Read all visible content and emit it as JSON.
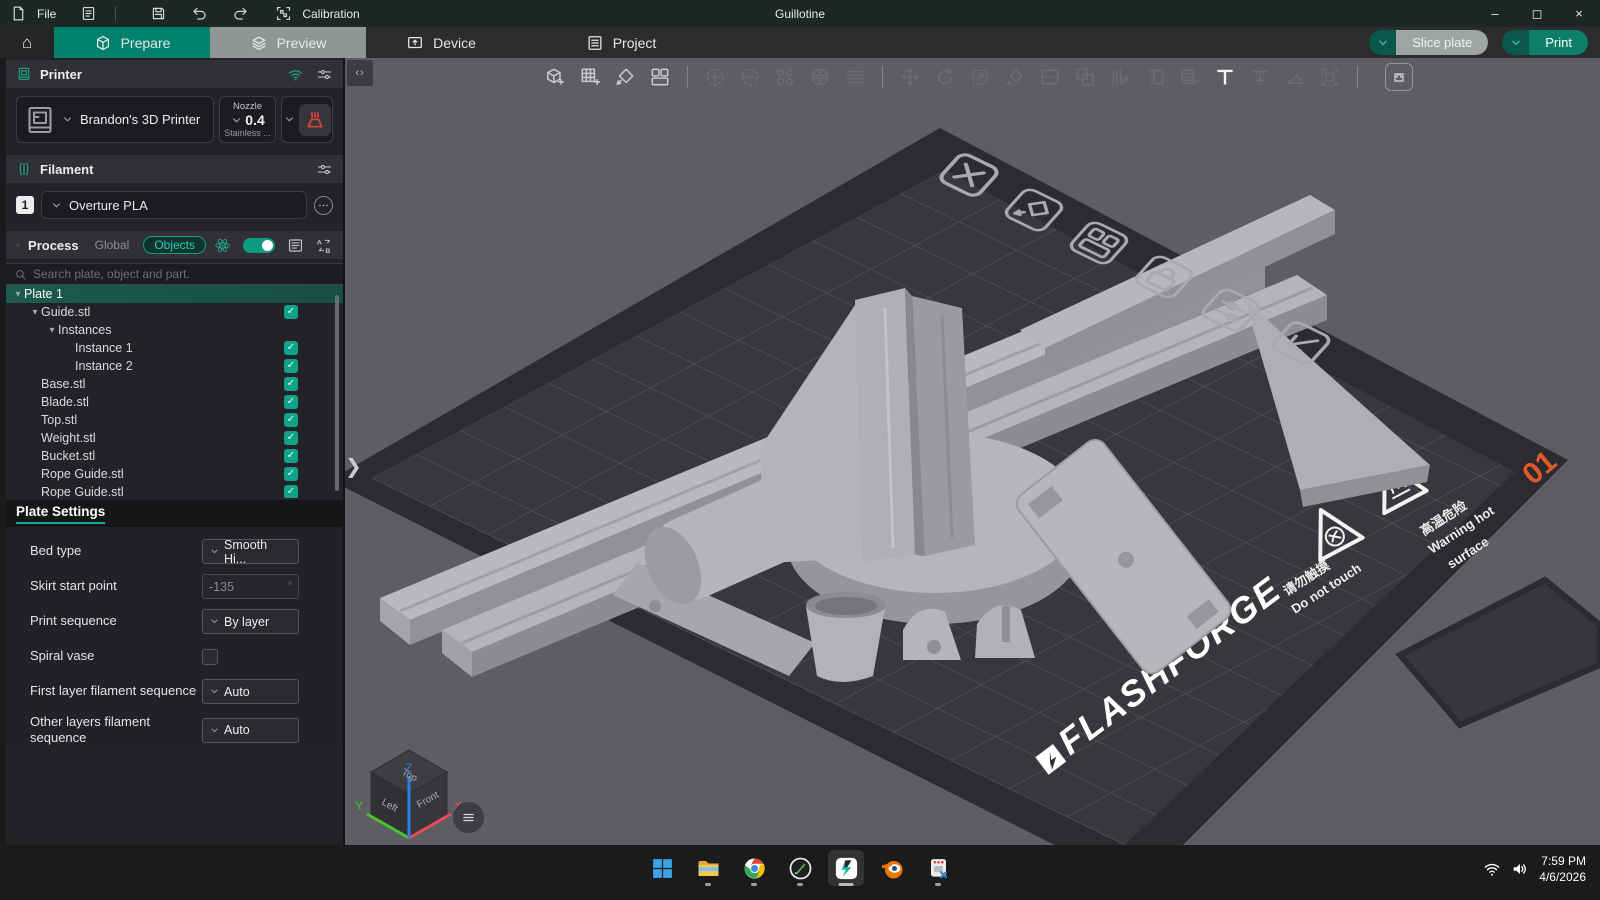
{
  "app": {
    "title": "Guillotine"
  },
  "menubar": {
    "file": "File",
    "calibration": "Calibration"
  },
  "window_controls": {
    "minimize": "–",
    "maximize": "◻",
    "close": "×"
  },
  "tabs": {
    "prepare": "Prepare",
    "preview": "Preview",
    "device": "Device",
    "project": "Project"
  },
  "actions": {
    "slice": "Slice plate",
    "print": "Print"
  },
  "printer": {
    "header": "Printer",
    "name": "Brandon's 3D Printer",
    "nozzle_label": "Nozzle",
    "nozzle_value": "0.4",
    "nozzle_material": "Stainless ..."
  },
  "filament": {
    "header": "Filament",
    "slot": "1",
    "name": "Overture PLA"
  },
  "process": {
    "header": "Process",
    "mode_global": "Global",
    "mode_objects": "Objects"
  },
  "search": {
    "placeholder": "Search plate, object and part."
  },
  "tree": {
    "rows": [
      {
        "label": "Plate 1",
        "level": 0,
        "caret": true,
        "selected": true,
        "checked": false
      },
      {
        "label": "Guide.stl",
        "level": 1,
        "caret": true,
        "checked": true
      },
      {
        "label": "Instances",
        "level": 2,
        "caret": true,
        "checked": false
      },
      {
        "label": "Instance 1",
        "level": 3,
        "caret": false,
        "checked": true
      },
      {
        "label": "Instance 2",
        "level": 3,
        "caret": false,
        "checked": true
      },
      {
        "label": "Base.stl",
        "level": 1,
        "caret": false,
        "checked": true
      },
      {
        "label": "Blade.stl",
        "level": 1,
        "caret": false,
        "checked": true
      },
      {
        "label": "Top.stl",
        "level": 1,
        "caret": false,
        "checked": true
      },
      {
        "label": "Weight.stl",
        "level": 1,
        "caret": false,
        "checked": true
      },
      {
        "label": "Bucket.stl",
        "level": 1,
        "caret": false,
        "checked": true
      },
      {
        "label": "Rope Guide.stl",
        "level": 1,
        "caret": false,
        "checked": true
      },
      {
        "label": "Rope Guide.stl",
        "level": 1,
        "caret": false,
        "checked": true
      }
    ]
  },
  "plate_settings": {
    "title": "Plate Settings",
    "bed_type": {
      "label": "Bed type",
      "value": "Smooth Hi..."
    },
    "skirt_start": {
      "label": "Skirt start point",
      "value": "-135",
      "unit": "°"
    },
    "print_sequence": {
      "label": "Print sequence",
      "value": "By layer"
    },
    "spiral_vase": {
      "label": "Spiral vase",
      "checked": false
    },
    "first_layer_seq": {
      "label": "First layer filament sequence",
      "value": "Auto"
    },
    "other_layers_seq": {
      "label": "Other layers filament sequence",
      "value": "Auto"
    }
  },
  "toolbar": {
    "items": [
      {
        "icon": "import-object",
        "enabled": true
      },
      {
        "icon": "add-plate",
        "enabled": true
      },
      {
        "icon": "auto-orient",
        "enabled": true
      },
      {
        "icon": "arrange",
        "enabled": true
      },
      {
        "sep": true
      },
      {
        "icon": "add-instance",
        "enabled": false
      },
      {
        "icon": "remove-instance",
        "enabled": false
      },
      {
        "icon": "split-to-objects",
        "enabled": false
      },
      {
        "icon": "split-to-parts",
        "enabled": false
      },
      {
        "icon": "variable-layers",
        "enabled": false
      },
      {
        "sep": true
      },
      {
        "icon": "move",
        "enabled": false
      },
      {
        "icon": "rotate",
        "enabled": false
      },
      {
        "icon": "scale",
        "enabled": false
      },
      {
        "icon": "lay-on-face",
        "enabled": false
      },
      {
        "icon": "cut",
        "enabled": false
      },
      {
        "icon": "mesh-boolean",
        "enabled": false
      },
      {
        "icon": "layer-height",
        "enabled": false
      },
      {
        "icon": "seam-painting",
        "enabled": false
      },
      {
        "icon": "fuzzy-skin",
        "enabled": false
      },
      {
        "icon": "text-tool",
        "enabled": true,
        "bright": true
      },
      {
        "icon": "fixture",
        "enabled": false
      },
      {
        "icon": "ramp",
        "enabled": false
      },
      {
        "icon": "frame",
        "enabled": false
      },
      {
        "sep": true
      },
      {
        "icon": "assembly",
        "enabled": true,
        "boxed": true
      }
    ]
  },
  "viewport": {
    "plate_label": "01",
    "logo": "FLASHFORGE",
    "warnings": {
      "touch_cn": "请勿触摸",
      "touch_en": "Do not touch",
      "hot_cn": "高温危险",
      "hot_en1": "Warning hot",
      "hot_en2": "surface"
    },
    "nav_cube": {
      "top": "Top",
      "left": "Left",
      "front": "Front",
      "axis_x": "X",
      "axis_y": "Y",
      "axis_z": "Z"
    },
    "plate_actions": [
      {
        "name": "delete-plate",
        "icon": "badge-x"
      },
      {
        "name": "orient-plate",
        "icon": "badge-orient"
      },
      {
        "name": "arrange-plate",
        "icon": "badge-arrange"
      },
      {
        "name": "lock-plate",
        "icon": "badge-lock"
      },
      {
        "name": "plate-settings",
        "icon": "badge-sliders"
      },
      {
        "name": "move-plate",
        "icon": "badge-arrow"
      }
    ]
  },
  "taskbar": {
    "time": "7:59 PM",
    "date": "4/6/2026",
    "apps": [
      {
        "name": "start",
        "icon": "app-start",
        "open": false,
        "active": false
      },
      {
        "name": "file-explorer",
        "icon": "app-explorer",
        "open": true,
        "active": false
      },
      {
        "name": "chrome",
        "icon": "app-chrome",
        "open": true,
        "active": false
      },
      {
        "name": "pen-app",
        "icon": "app-pen",
        "open": true,
        "active": false
      },
      {
        "name": "flashforge-slicer",
        "icon": "app-flashforge",
        "open": true,
        "active": true
      },
      {
        "name": "blender",
        "icon": "app-blender",
        "open": false,
        "active": false
      },
      {
        "name": "snipping-tool",
        "icon": "app-snip",
        "open": true,
        "active": false
      }
    ]
  },
  "colors": {
    "accent": "#00816c",
    "accent_bright": "#14b099",
    "warning_red": "#cf4638",
    "plate_label_orange": "#e0592c"
  }
}
